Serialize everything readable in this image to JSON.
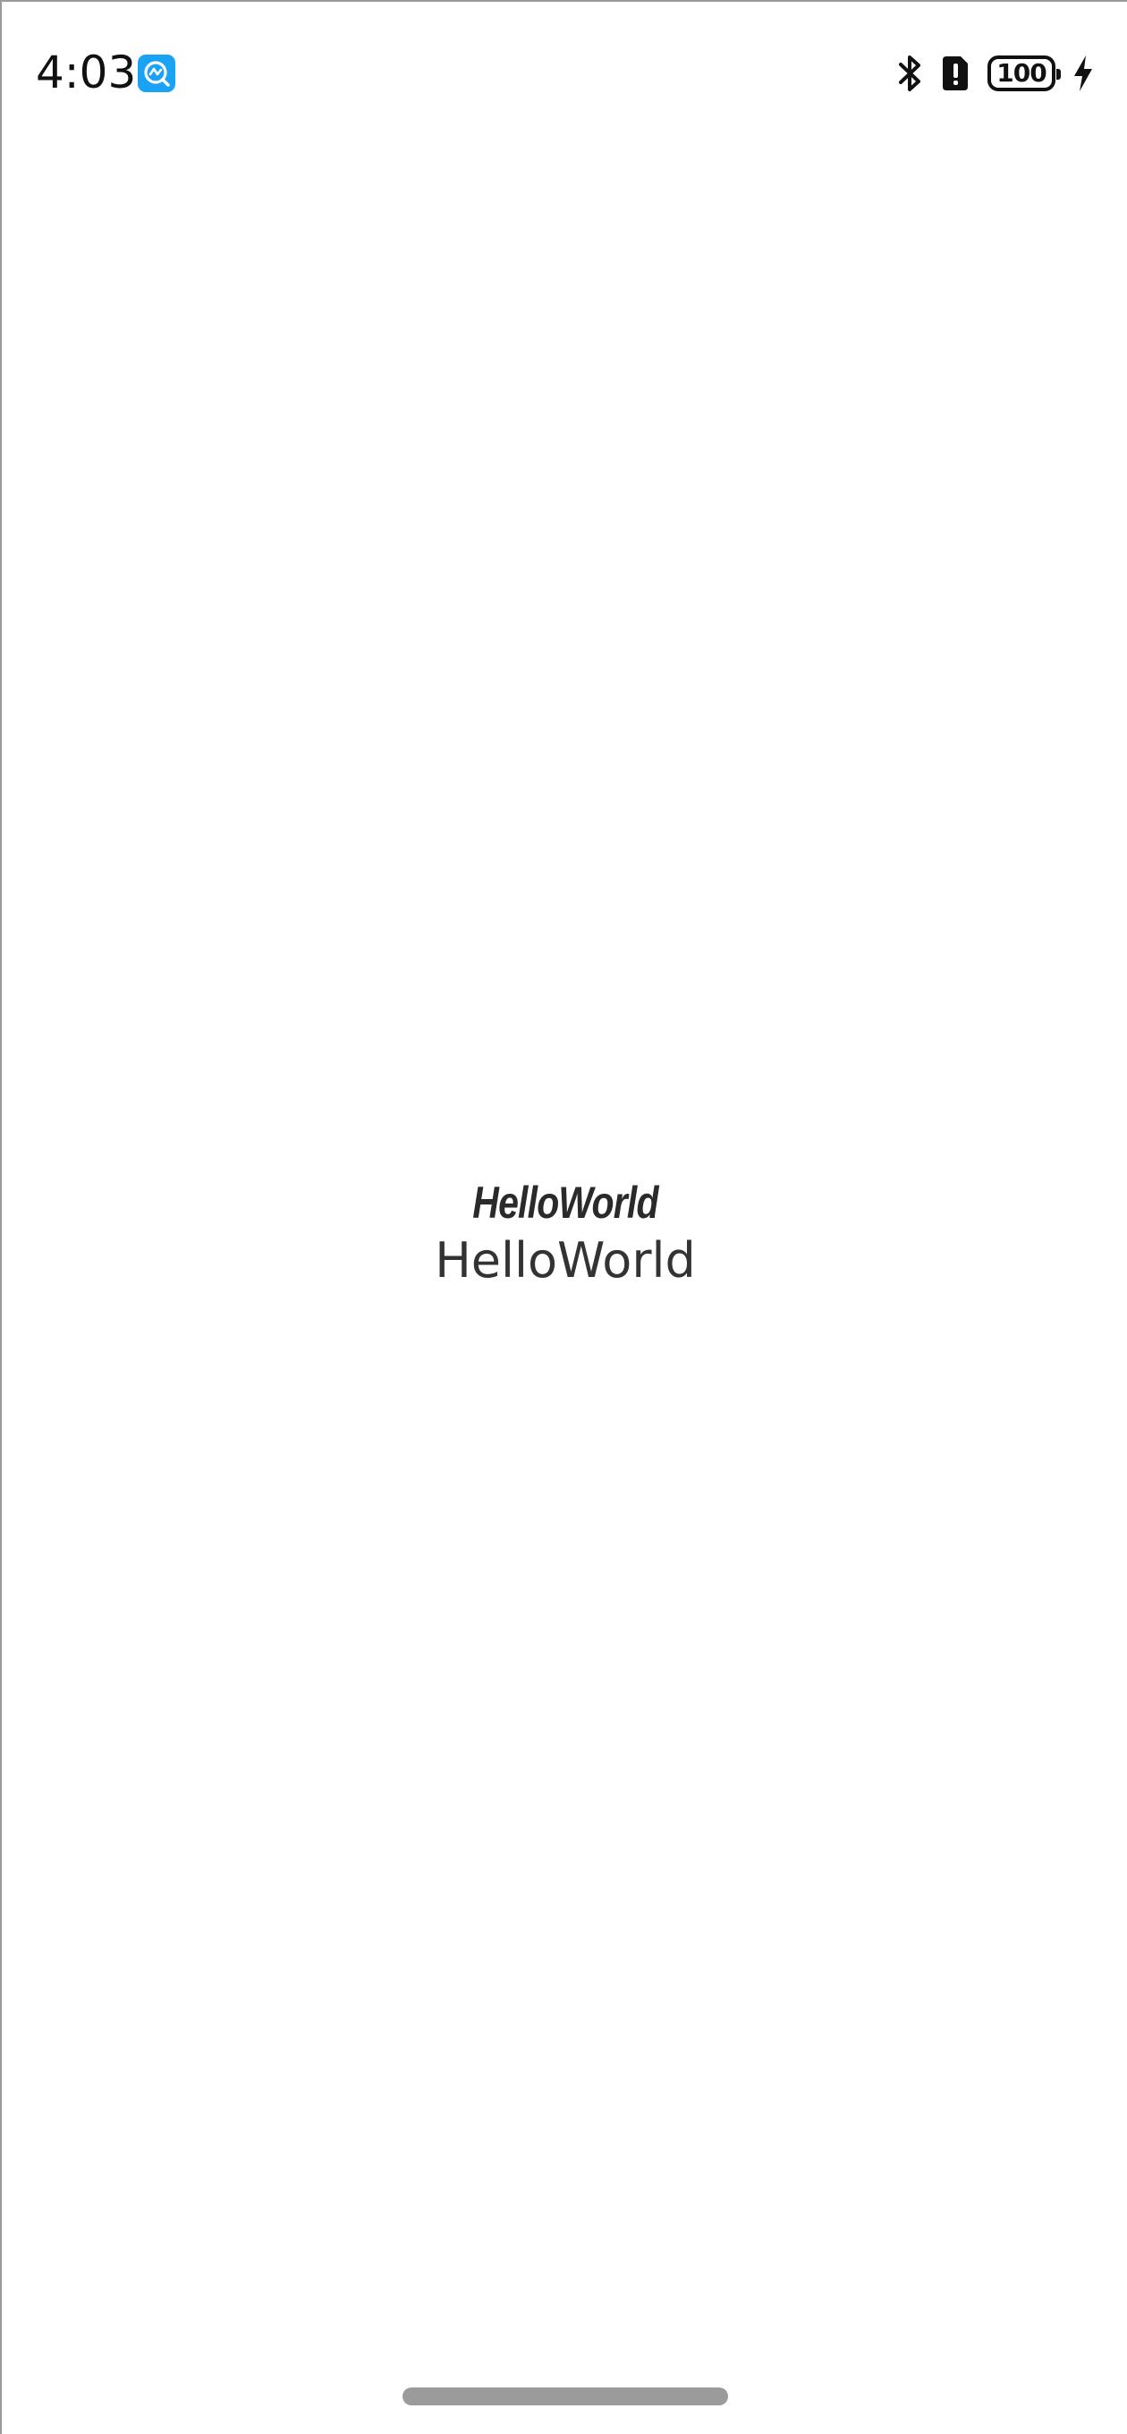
{
  "status_bar": {
    "time": "4:03",
    "notification_icon": "app-monitor-icon",
    "icons": [
      "bluetooth-icon",
      "alert-icon",
      "battery-icon",
      "charging-icon"
    ],
    "battery_level": "100"
  },
  "main": {
    "text_styled": "HelloWorld",
    "text_plain": "HelloWorld"
  },
  "colors": {
    "accent": "#1aa3f5",
    "text": "#333333",
    "home_indicator": "#9b9b9b"
  }
}
